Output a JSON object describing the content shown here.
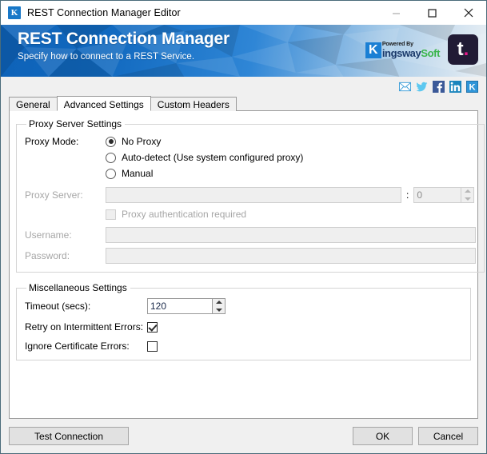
{
  "window": {
    "title": "REST Connection Manager Editor",
    "icon": "kingswaysoft-k-icon",
    "controls": [
      {
        "name": "minimize-button",
        "glyph": "minimize"
      },
      {
        "name": "maximize-button",
        "glyph": "maximize"
      },
      {
        "name": "close-button",
        "glyph": "close"
      }
    ]
  },
  "banner": {
    "title": "REST Connection Manager",
    "subtitle": "Specify how to connect to a REST Service.",
    "brand": {
      "k": "K",
      "powered_by": "Powered By",
      "name_part1": "ingsway",
      "name_part2": "Soft",
      "product_mark": "t",
      "product_dot": "."
    },
    "colors": {
      "banner_blue": "#1169bf",
      "brand_blue": "#1b3a6b",
      "brand_green": "#39b54a",
      "product_bg": "#211b35",
      "product_accent": "#e8198b"
    }
  },
  "social": [
    {
      "name": "email-icon",
      "label": "Email"
    },
    {
      "name": "twitter-icon",
      "label": "Twitter"
    },
    {
      "name": "facebook-icon",
      "label": "Facebook"
    },
    {
      "name": "linkedin-icon",
      "label": "LinkedIn"
    },
    {
      "name": "kingswaysoft-icon",
      "label": "KingswaySoft"
    }
  ],
  "tabs": [
    {
      "label": "General",
      "active": false
    },
    {
      "label": "Advanced Settings",
      "active": true
    },
    {
      "label": "Custom Headers",
      "active": false
    }
  ],
  "proxy_group": {
    "legend": "Proxy Server Settings",
    "mode_label": "Proxy Mode:",
    "modes": [
      {
        "label": "No Proxy",
        "selected": true
      },
      {
        "label": "Auto-detect (Use system configured proxy)",
        "selected": false
      },
      {
        "label": "Manual",
        "selected": false
      }
    ],
    "server_label": "Proxy Server:",
    "server_value": "",
    "port_separator": ":",
    "port_value": "0",
    "auth_checkbox_label": "Proxy authentication required",
    "auth_checked": false,
    "username_label": "Username:",
    "username_value": "",
    "password_label": "Password:",
    "password_value": ""
  },
  "misc_group": {
    "legend": "Miscellaneous Settings",
    "timeout_label": "Timeout (secs):",
    "timeout_value": "120",
    "retry_label": "Retry on Intermittent Errors:",
    "retry_checked": true,
    "ignore_cert_label": "Ignore Certificate Errors:",
    "ignore_cert_checked": false
  },
  "footer": {
    "test_label": "Test Connection",
    "ok_label": "OK",
    "cancel_label": "Cancel"
  }
}
